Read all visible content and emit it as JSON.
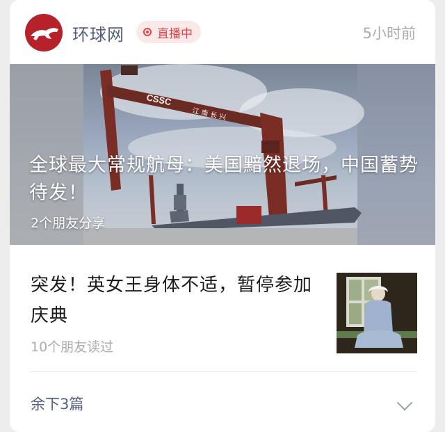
{
  "header": {
    "source_name": "环球网",
    "live_label": "直播中",
    "time_ago": "5小时前"
  },
  "hero": {
    "title": "全球最大常规航母：美国黯然退场，中国蓄势待发！",
    "shares": "2个朋友分享",
    "crane_logo_text": "CSSC",
    "crane_chinese_text": "江 南 长 兴"
  },
  "article2": {
    "title": "突发！英女王身体不适，暂停参加庆典",
    "reads": "10个朋友读过"
  },
  "footer": {
    "more_label": "余下3篇"
  },
  "colors": {
    "brand": "#b5222a",
    "live": "#e0454a",
    "source": "#555e7a",
    "muted": "#a9acb2"
  },
  "icons": [
    "tiger-logo-icon",
    "live-dot-icon",
    "chevron-down-icon"
  ]
}
